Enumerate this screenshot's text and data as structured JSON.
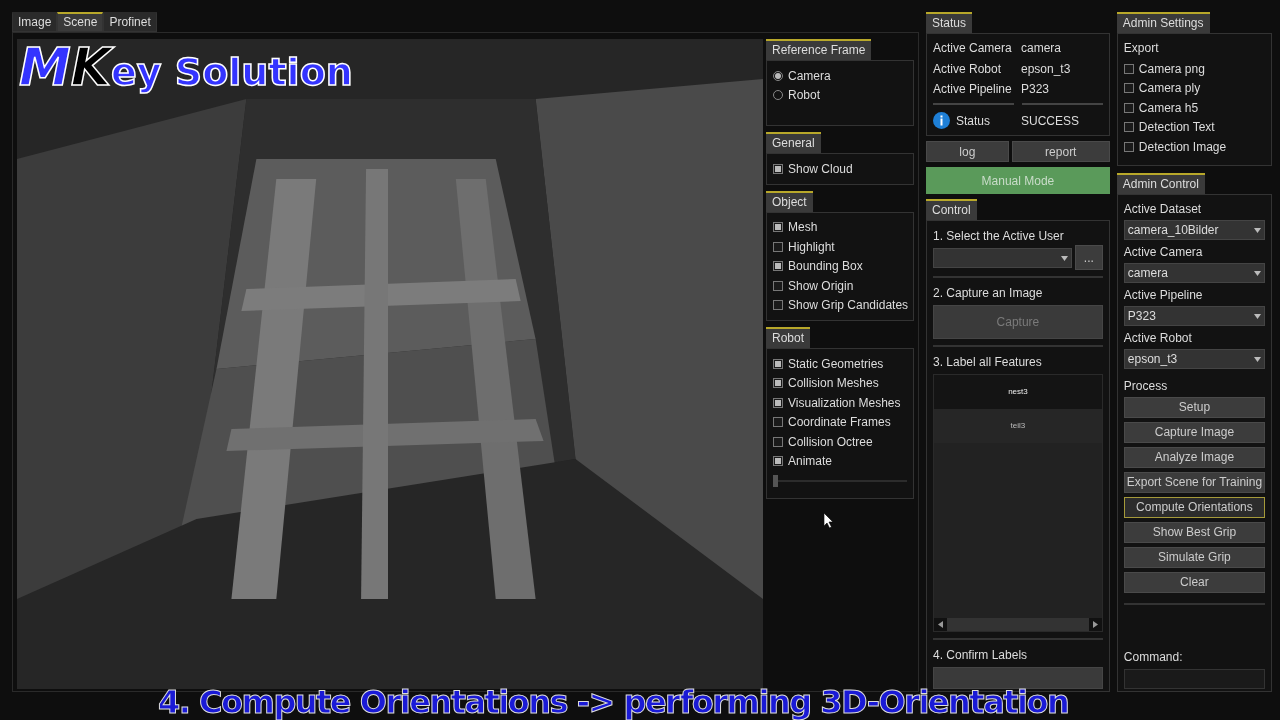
{
  "tabs": [
    {
      "label": "Image",
      "selected": false
    },
    {
      "label": "Scene",
      "selected": true
    },
    {
      "label": "Profinet",
      "selected": false
    }
  ],
  "overlay": {
    "logo": "MKey Solution",
    "caption": "4. Compute Orientations -> performing 3D-Orientation"
  },
  "view_panels": [
    {
      "title": "Reference Frame",
      "items": [
        {
          "kind": "radio",
          "label": "Camera",
          "checked": true
        },
        {
          "kind": "radio",
          "label": "Robot",
          "checked": false
        }
      ]
    },
    {
      "title": "General",
      "items": [
        {
          "kind": "checkbox",
          "label": "Show Cloud",
          "checked": true
        }
      ]
    },
    {
      "title": "Object",
      "items": [
        {
          "kind": "checkbox",
          "label": "Mesh",
          "checked": true
        },
        {
          "kind": "checkbox",
          "label": "Highlight",
          "checked": false
        },
        {
          "kind": "checkbox",
          "label": "Bounding Box",
          "checked": true
        },
        {
          "kind": "checkbox",
          "label": "Show Origin",
          "checked": false
        },
        {
          "kind": "checkbox",
          "label": "Show Grip Candidates",
          "checked": false
        }
      ]
    },
    {
      "title": "Robot",
      "items": [
        {
          "kind": "checkbox",
          "label": "Static Geometries",
          "checked": true
        },
        {
          "kind": "checkbox",
          "label": "Collision Meshes",
          "checked": true
        },
        {
          "kind": "checkbox",
          "label": "Visualization Meshes",
          "checked": true
        },
        {
          "kind": "checkbox",
          "label": "Coordinate Frames",
          "checked": false
        },
        {
          "kind": "checkbox",
          "label": "Collision Octree",
          "checked": false
        },
        {
          "kind": "checkbox",
          "label": "Animate",
          "checked": true
        },
        {
          "kind": "slider",
          "level": 0
        }
      ]
    }
  ],
  "status": {
    "title": "Status",
    "rows": [
      {
        "label": "Active Camera",
        "value": "camera"
      },
      {
        "label": "Active Robot",
        "value": "epson_t3"
      },
      {
        "label": "Active Pipeline",
        "value": "P323"
      }
    ],
    "state": {
      "label": "Status",
      "value": "SUCCESS"
    }
  },
  "status_buttons": [
    "log",
    "report"
  ],
  "mode_button": "Manual Mode",
  "control": {
    "title": "Control",
    "steps": [
      {
        "kind": "select",
        "label": "1. Select the Active User",
        "button": "..."
      },
      {
        "kind": "button",
        "label": "2. Capture an Image",
        "button": "Capture",
        "disabled": true
      },
      {
        "kind": "list",
        "label": "3. Label all Features",
        "items": [
          {
            "label": "nest3",
            "selected": true
          },
          {
            "label": "teil3",
            "selected": false
          }
        ]
      },
      {
        "kind": "button",
        "label": "4. Confirm Labels",
        "disabled": true
      }
    ]
  },
  "admin_settings": {
    "title": "Admin Settings",
    "group": "Export",
    "options": [
      {
        "label": "Camera png",
        "checked": false
      },
      {
        "label": "Camera ply",
        "checked": false
      },
      {
        "label": "Camera h5",
        "checked": false
      },
      {
        "label": "Detection Text",
        "checked": false
      },
      {
        "label": "Detection Image",
        "checked": false
      }
    ]
  },
  "admin_control": {
    "title": "Admin Control",
    "selects": [
      {
        "label": "Active Dataset",
        "value": "camera_10Bilder"
      },
      {
        "label": "Active Camera",
        "value": "camera"
      },
      {
        "label": "Active Pipeline",
        "value": "P323"
      },
      {
        "label": "Active Robot",
        "value": "epson_t3"
      }
    ],
    "process_label": "Process",
    "buttons": [
      {
        "label": "Setup",
        "focused": false
      },
      {
        "label": "Capture Image",
        "focused": false
      },
      {
        "label": "Analyze Image",
        "focused": false
      },
      {
        "label": "Export Scene for Training",
        "focused": false
      },
      {
        "label": "Compute Orientations",
        "focused": true
      },
      {
        "label": "Show Best Grip",
        "focused": false
      },
      {
        "label": "Simulate Grip",
        "focused": false
      },
      {
        "label": "Clear",
        "focused": false
      }
    ],
    "command_label": "Command:"
  }
}
